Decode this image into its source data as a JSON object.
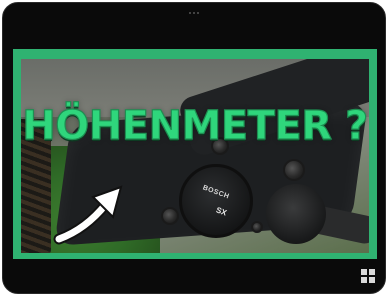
{
  "video": {
    "headline": "HÖHENMETER ?",
    "motor_brand": "BOSCH",
    "motor_model": "SX"
  },
  "controls": {
    "fullscreen_icon": "fullscreen-icon"
  },
  "colors": {
    "thumbnail_border": "#2fb271",
    "headline_text": "#2fd67c",
    "device_bezel": "#0a0a0a"
  }
}
